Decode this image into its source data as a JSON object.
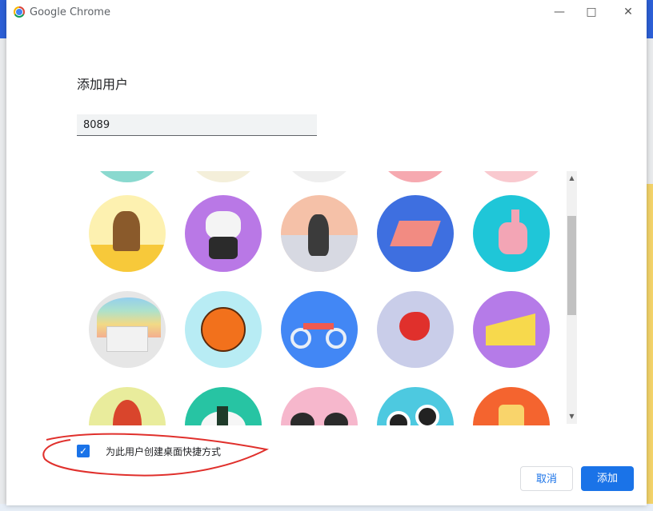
{
  "window": {
    "title": "Google Chrome",
    "minimize_icon": "minimize-icon",
    "maximize_icon": "maximize-icon",
    "close_icon": "close-icon"
  },
  "dialog": {
    "heading": "添加用户",
    "name_value": "8089",
    "checkbox_label": "为此用户创建桌面快捷方式",
    "checkbox_checked": true,
    "cancel_label": "取消",
    "add_label": "添加"
  },
  "avatars": [
    {
      "name": "monkey",
      "bg": "#fdf1b0"
    },
    {
      "name": "panda",
      "bg": "#b978e6"
    },
    {
      "name": "penguin",
      "bg": "#f5c1a8"
    },
    {
      "name": "butterfly",
      "bg": "#3e6fe0"
    },
    {
      "name": "rabbit",
      "bg": "#1fc6d8"
    },
    {
      "name": "unicorn",
      "bg": "#e6e6e6"
    },
    {
      "name": "basketball",
      "bg": "#b8ecf4"
    },
    {
      "name": "bicycle",
      "bg": "#4287f5"
    },
    {
      "name": "bird",
      "bg": "#c9cde9"
    },
    {
      "name": "cheese",
      "bg": "#b57be8"
    },
    {
      "name": "football",
      "bg": "#e9ec9c"
    },
    {
      "name": "sushi-plate",
      "bg": "#27c4a3"
    },
    {
      "name": "sunglasses",
      "bg": "#f6b7cc"
    },
    {
      "name": "sushi",
      "bg": "#4dc9e0"
    },
    {
      "name": "lantern",
      "bg": "#f4642f"
    }
  ],
  "colors": {
    "accent": "#1a73e8",
    "annotation": "#e0302c"
  }
}
